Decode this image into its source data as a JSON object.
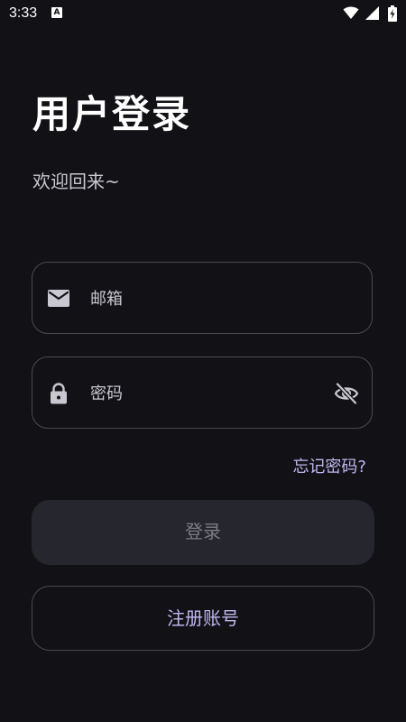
{
  "status_bar": {
    "time": "3:33",
    "notification_badge": "A",
    "icons": [
      "wifi-icon",
      "signal-icon",
      "battery-charging-icon"
    ]
  },
  "header": {
    "title": "用户登录",
    "subtitle": "欢迎回来~"
  },
  "form": {
    "email": {
      "placeholder": "邮箱",
      "value": "",
      "icon": "mail-icon"
    },
    "password": {
      "placeholder": "密码",
      "value": "",
      "icon": "lock-icon",
      "toggle_icon": "eye-off-icon"
    },
    "forgot_password_label": "忘记密码?",
    "login_label": "登录",
    "register_label": "注册账号"
  },
  "colors": {
    "background": "#111116",
    "accent": "#c2b6f0",
    "border": "#4a4a52",
    "disabled_button_bg": "#26262e",
    "disabled_button_text": "#7d7c85",
    "placeholder": "#c9c8d0"
  }
}
